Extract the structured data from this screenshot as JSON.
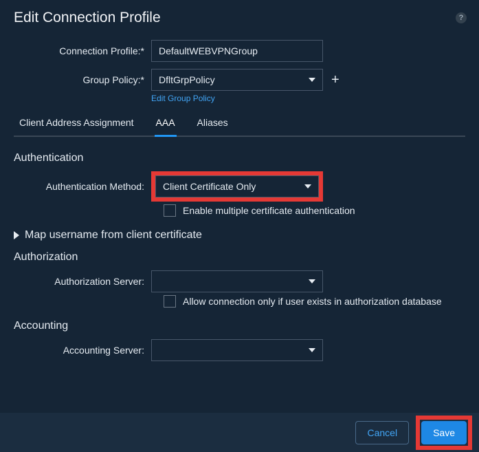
{
  "dialog": {
    "title": "Edit Connection Profile"
  },
  "form": {
    "connection_profile": {
      "label": "Connection Profile:*",
      "value": "DefaultWEBVPNGroup"
    },
    "group_policy": {
      "label": "Group Policy:*",
      "value": "DfltGrpPolicy",
      "edit_link": "Edit Group Policy"
    }
  },
  "tabs": [
    "Client Address Assignment",
    "AAA",
    "Aliases"
  ],
  "sections": {
    "authentication": {
      "heading": "Authentication",
      "method_label": "Authentication Method:",
      "method_value": "Client Certificate Only",
      "enable_multi_cert": "Enable multiple certificate authentication"
    },
    "map_username": "Map username from client certificate",
    "authorization": {
      "heading": "Authorization",
      "server_label": "Authorization Server:",
      "server_value": "",
      "allow_only_if_exists": "Allow connection only if user exists in authorization database"
    },
    "accounting": {
      "heading": "Accounting",
      "server_label": "Accounting Server:",
      "server_value": ""
    }
  },
  "footer": {
    "cancel": "Cancel",
    "save": "Save"
  }
}
